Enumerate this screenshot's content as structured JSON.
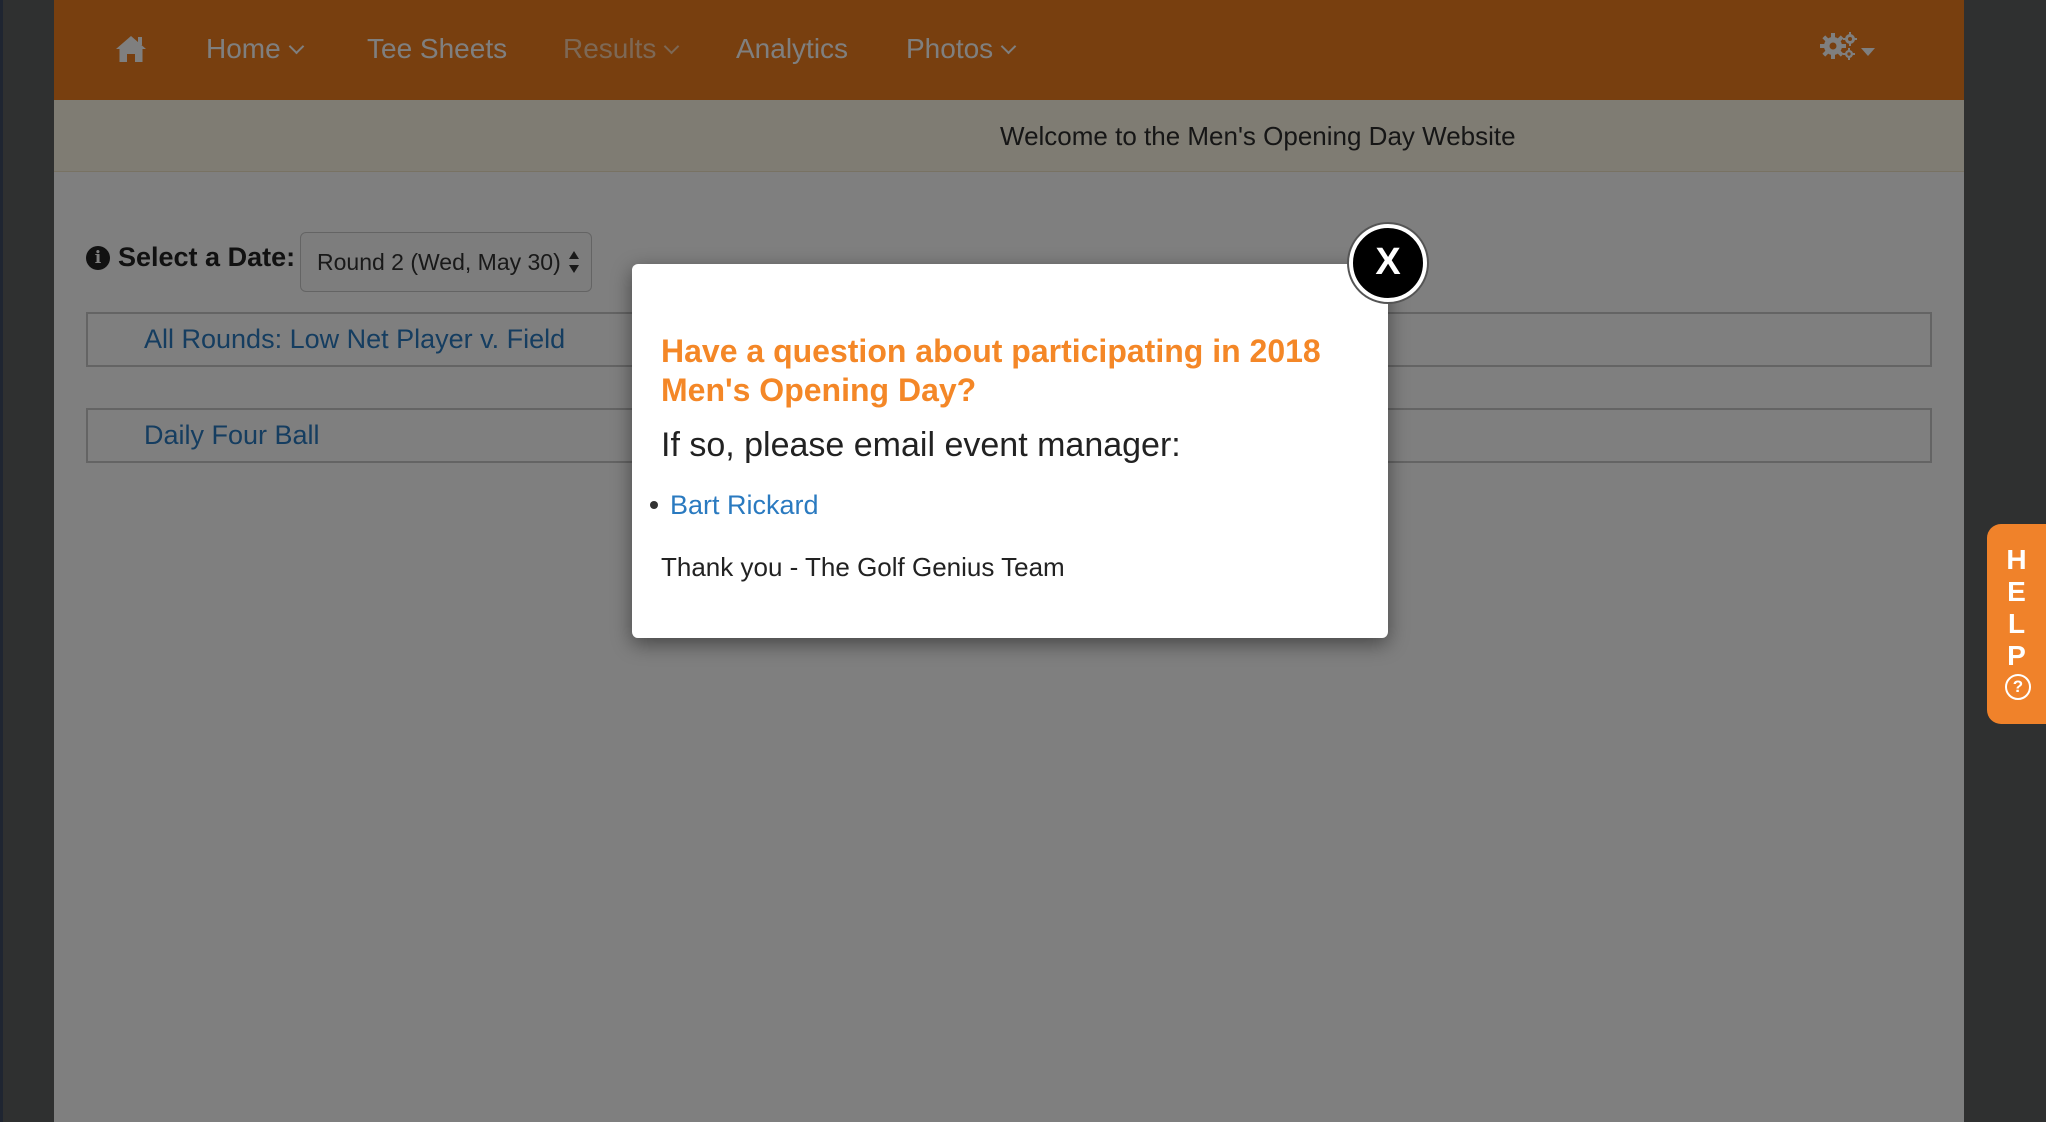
{
  "navbar": {
    "home_icon": "home-icon",
    "items": [
      {
        "label": "Home",
        "has_dropdown": true
      },
      {
        "label": "Tee Sheets",
        "has_dropdown": false
      },
      {
        "label": "Results",
        "has_dropdown": true
      },
      {
        "label": "Analytics",
        "has_dropdown": false
      },
      {
        "label": "Photos",
        "has_dropdown": true
      }
    ],
    "settings_icon": "gears-icon",
    "color": "#f07f1f"
  },
  "welcome": {
    "text": "Welcome to the Men's Opening Day Website"
  },
  "date_select": {
    "label": "Select a Date:",
    "value": "Round 2 (Wed, May 30)"
  },
  "panels": [
    {
      "label": "All Rounds: Low Net Player v. Field"
    },
    {
      "label": "Daily Four Ball"
    }
  ],
  "modal": {
    "title": "Have a question about participating in 2018 Men's Opening Day?",
    "subtitle": "If so, please email event manager:",
    "contacts": [
      "Bart Rickard"
    ],
    "thanks": "Thank you - The Golf Genius Team",
    "close_label": "X",
    "title_color": "#f48727"
  },
  "help_tab": {
    "letters": [
      "H",
      "E",
      "L",
      "P"
    ],
    "icon": "question-circle-icon",
    "icon_glyph": "?"
  }
}
